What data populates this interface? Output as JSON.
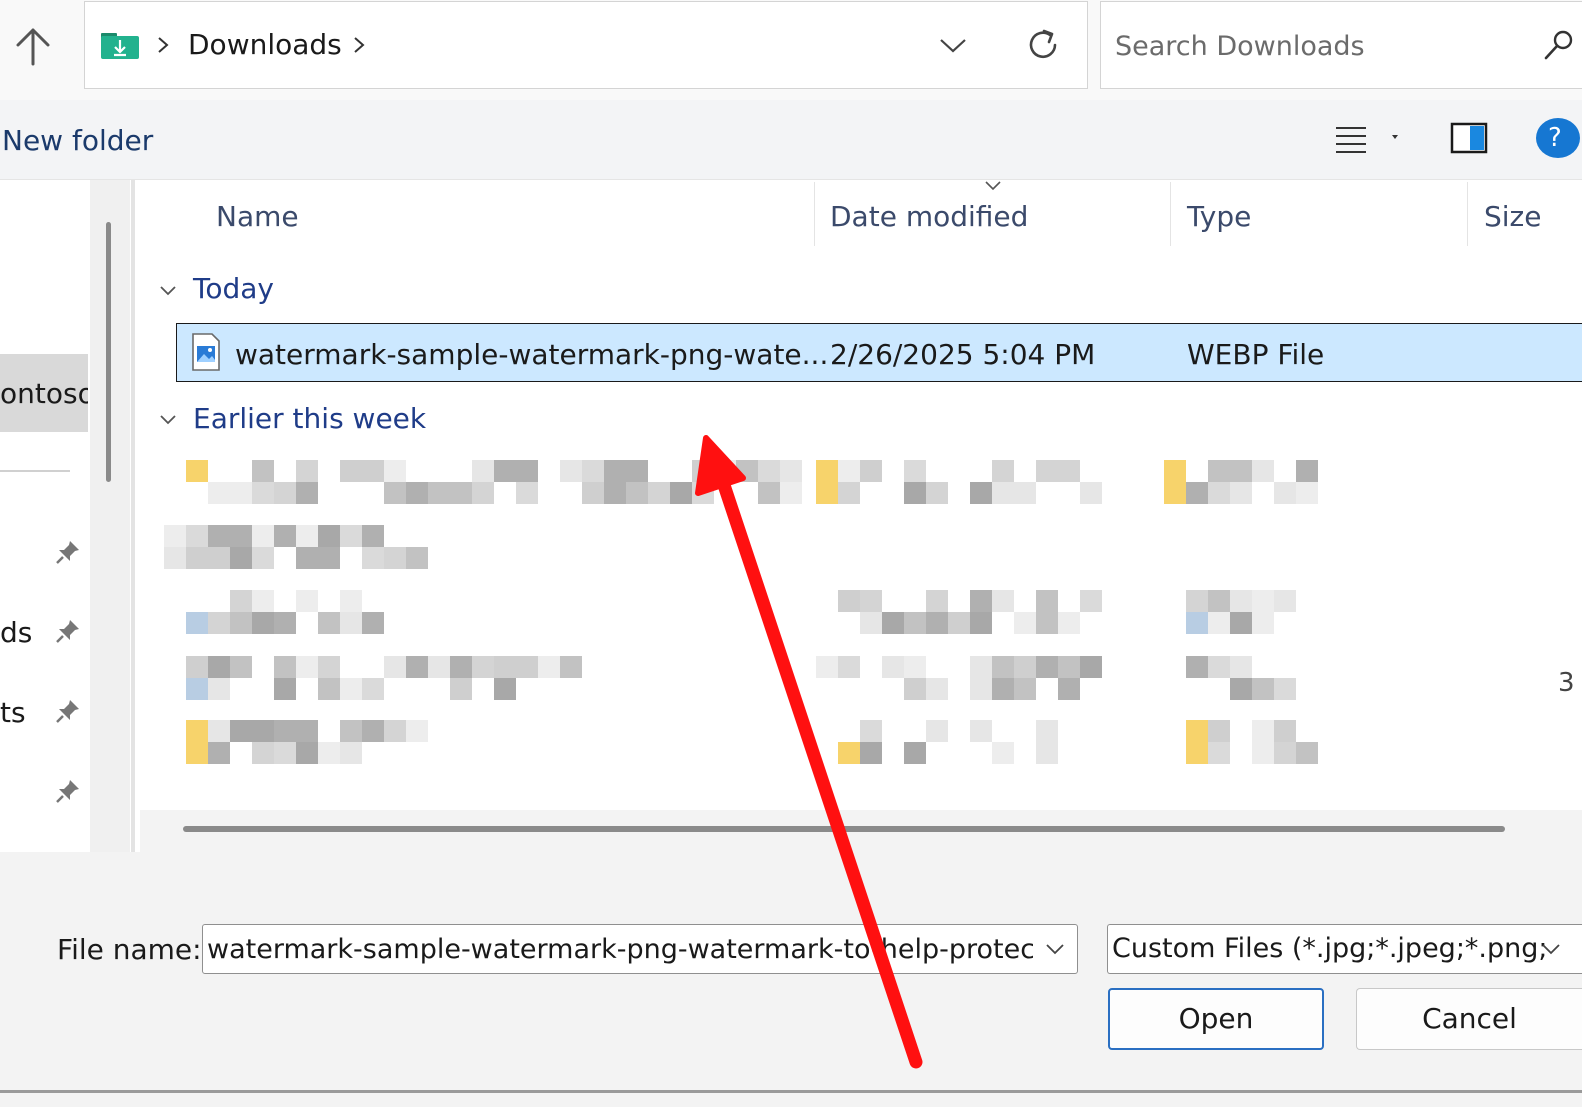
{
  "address_bar": {
    "path_label": "Downloads",
    "search_placeholder": "Search Downloads"
  },
  "command_bar": {
    "new_folder_label": "New folder",
    "help_label": "?"
  },
  "nav_pane": {
    "selected_item_label": "ontoso",
    "pinned_items": [
      "ds",
      "ts"
    ]
  },
  "columns": {
    "name": "Name",
    "date_modified": "Date modified",
    "type": "Type",
    "size": "Size"
  },
  "groups": {
    "today": "Today",
    "earlier": "Earlier this week"
  },
  "selected_file": {
    "name": "watermark-sample-watermark-png-wate...",
    "date": "2/26/2025 5:04 PM",
    "type": "WEBP File"
  },
  "edge_digit": "3",
  "bottom_bar": {
    "file_name_label": "File name:",
    "file_name_value": "watermark-sample-watermark-png-watermark-to-help-protect",
    "filter_label": "Custom Files (*.jpg;*.jpeg;*.png;",
    "open_label": "Open",
    "cancel_label": "Cancel"
  },
  "colors": {
    "selection_bg": "#cce8ff",
    "group_label": "#1f3c88",
    "accent": "#1677d2",
    "annotation_arrow": "#ff0000"
  },
  "icons": {
    "up": "arrow-up-icon",
    "folder": "downloads-folder-icon",
    "refresh": "refresh-icon",
    "search": "search-icon",
    "view": "list-view-icon",
    "preview": "preview-pane-icon",
    "pin": "pin-icon",
    "file": "image-file-icon"
  }
}
